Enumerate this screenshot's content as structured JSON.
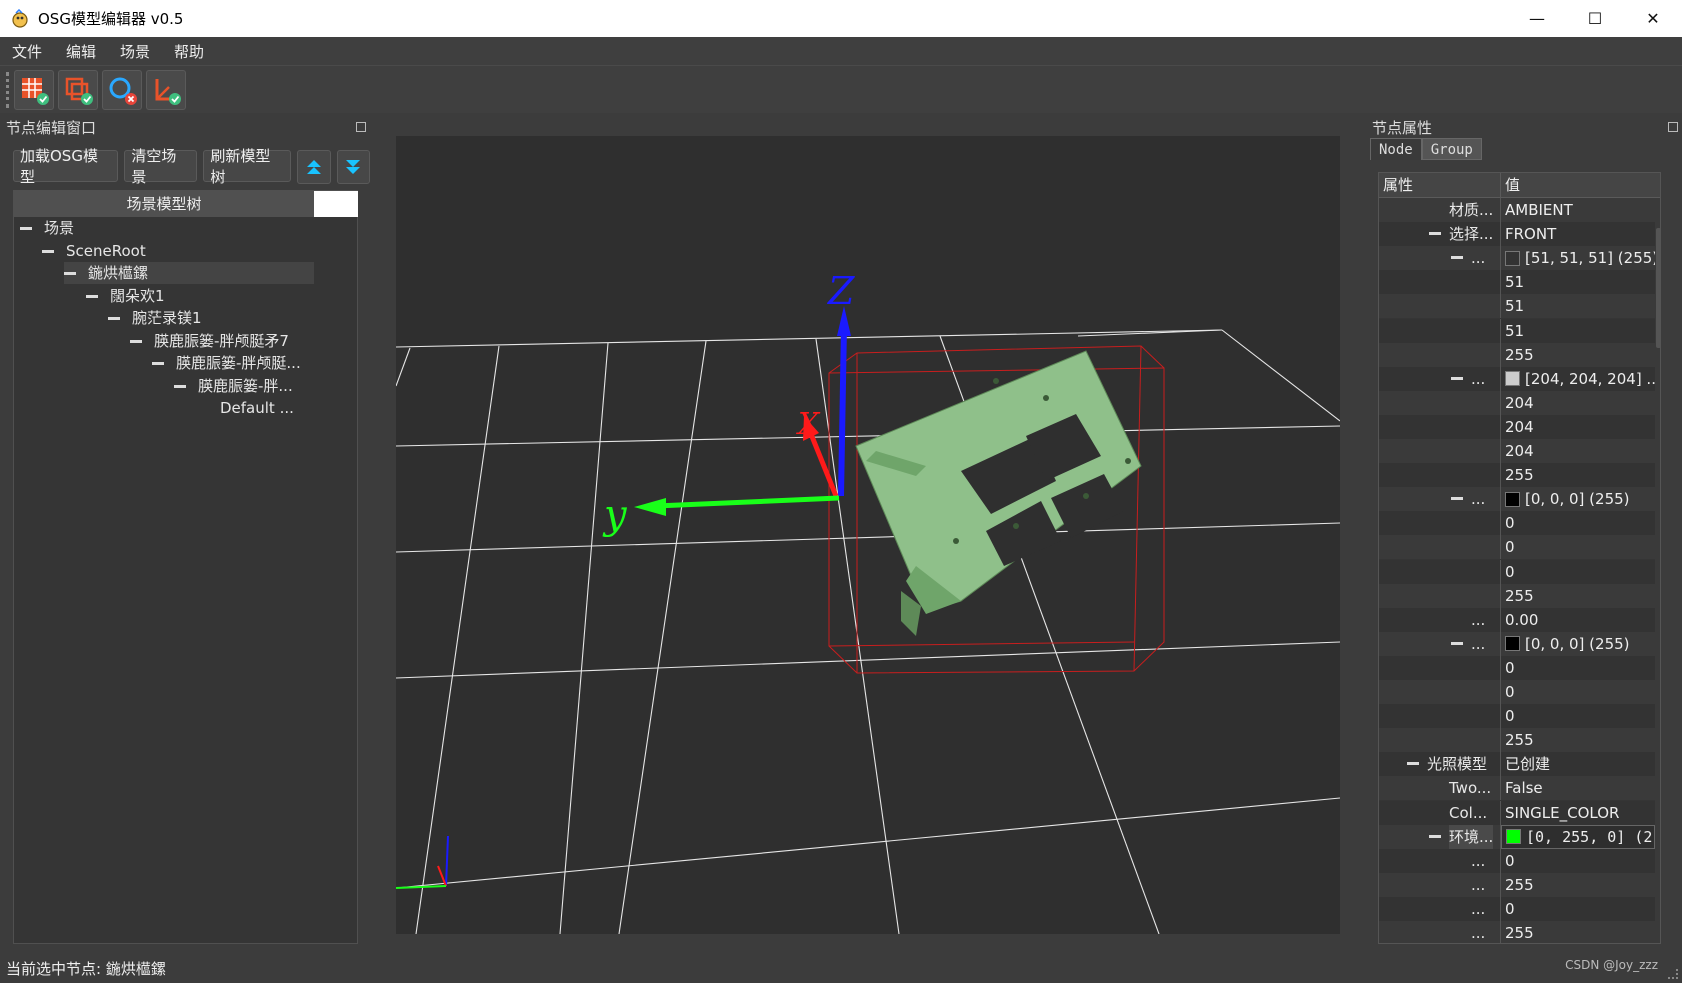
{
  "window": {
    "title": "OSG模型编辑器 v0.5",
    "controls": [
      "—",
      "☐",
      "✕"
    ]
  },
  "menu": [
    "文件",
    "编辑",
    "场景",
    "帮助"
  ],
  "toolbar": {
    "buttons": [
      "table-check-icon",
      "layers-check-icon",
      "search-remove-icon",
      "axis-check-icon"
    ]
  },
  "left_panel": {
    "title": "节点编辑窗口",
    "buttons": {
      "load": "加载OSG模型",
      "clear": "清空场景",
      "refresh": "刷新模型树"
    },
    "tree_header": "场景模型树",
    "tree": [
      {
        "label": "场景",
        "depth": 0
      },
      {
        "label": "SceneRoot",
        "depth": 1
      },
      {
        "label": "鍦烘櫙鏍",
        "depth": 2
      },
      {
        "label": "闊朵欢1",
        "depth": 3
      },
      {
        "label": "腕茫录镁1",
        "depth": 4
      },
      {
        "label": "朠鹿脤篓-胖颅脡矛7",
        "depth": 5
      },
      {
        "label": "朠鹿脤篓-胖颅脡...",
        "depth": 6
      },
      {
        "label": "朠鹿脤篓-胖...",
        "depth": 7
      },
      {
        "label": "Default ...",
        "depth": 8
      }
    ]
  },
  "viewport": {
    "axis_labels": {
      "z": "Z",
      "x": "X",
      "y": "y"
    },
    "colors": {
      "background": "#2f2f2f",
      "grid": "#e0e0e0",
      "model": "#8fc08a",
      "bbox": "#c81e1e",
      "x_axis": "#ff1a1a",
      "y_axis": "#19ff19",
      "z_axis": "#1a1aff"
    }
  },
  "right_panel": {
    "title": "节点属性",
    "tabs": [
      "Node",
      "Group"
    ],
    "columns": [
      "属性",
      "值"
    ],
    "rows": [
      {
        "key": "材质...",
        "value": "AMBIENT"
      },
      {
        "key": "选择...",
        "value": "FRONT"
      },
      {
        "key": "...",
        "value": "[51, 51, 51] (255)",
        "swatch": "#333333"
      },
      {
        "key": "",
        "value": "51"
      },
      {
        "key": "",
        "value": "51"
      },
      {
        "key": "",
        "value": "51"
      },
      {
        "key": "",
        "value": "255"
      },
      {
        "key": "...",
        "value": "[204, 204, 204] ...",
        "swatch": "#cccccc"
      },
      {
        "key": "",
        "value": "204"
      },
      {
        "key": "",
        "value": "204"
      },
      {
        "key": "",
        "value": "204"
      },
      {
        "key": "",
        "value": "255"
      },
      {
        "key": "...",
        "value": "[0, 0, 0] (255)",
        "swatch": "#000000"
      },
      {
        "key": "",
        "value": "0"
      },
      {
        "key": "",
        "value": "0"
      },
      {
        "key": "",
        "value": "0"
      },
      {
        "key": "",
        "value": "255"
      },
      {
        "key": "...",
        "value": "0.00"
      },
      {
        "key": "...",
        "value": "[0, 0, 0] (255)",
        "swatch": "#000000"
      },
      {
        "key": "",
        "value": "0"
      },
      {
        "key": "",
        "value": "0"
      },
      {
        "key": "",
        "value": "0"
      },
      {
        "key": "",
        "value": "255"
      },
      {
        "key": "光照模型",
        "value": "已创建"
      },
      {
        "key": "Two...",
        "value": "False"
      },
      {
        "key": "Col...",
        "value": "SINGLE_COLOR"
      },
      {
        "key": "环境...",
        "value": "[0,  255,  0]  (2!",
        "swatch": "#00ff00",
        "editing": true
      },
      {
        "key": "...",
        "value": "0"
      },
      {
        "key": "...",
        "value": "255"
      },
      {
        "key": "...",
        "value": "0"
      },
      {
        "key": "...",
        "value": "255"
      }
    ]
  },
  "status": {
    "text": "当前选中节点: 鍦烘櫙鏍",
    "watermark": "CSDN @Joy_zzz"
  }
}
